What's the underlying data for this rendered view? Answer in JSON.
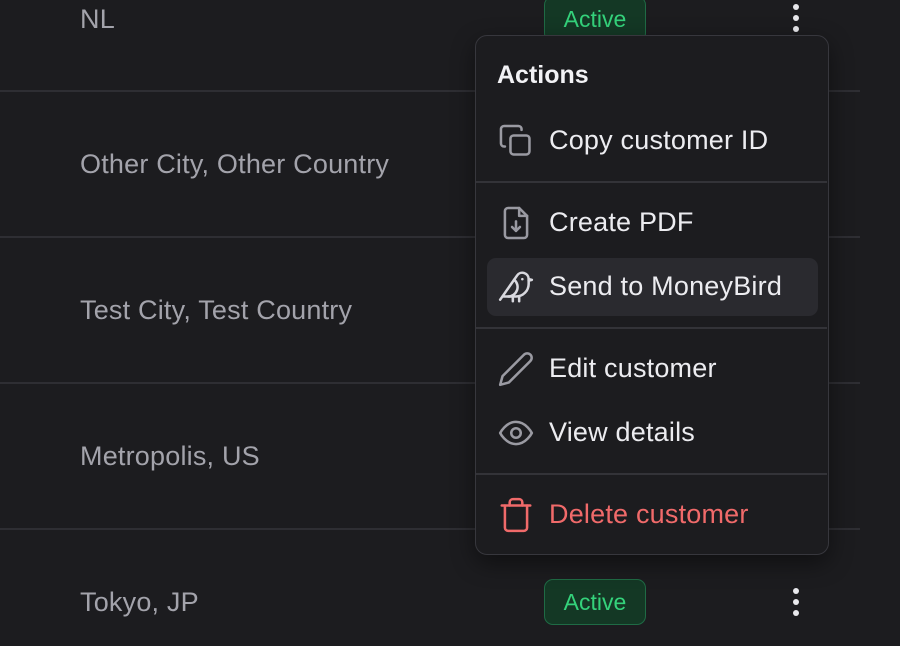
{
  "table": {
    "rows": [
      {
        "location": "NL",
        "status": "Active"
      },
      {
        "location": "Other City, Other Country",
        "status": ""
      },
      {
        "location": "Test City, Test Country",
        "status": ""
      },
      {
        "location": "Metropolis, US",
        "status": ""
      },
      {
        "location": "Tokyo, JP",
        "status": "Active"
      }
    ]
  },
  "menu": {
    "title": "Actions",
    "items": [
      {
        "label": "Copy customer ID",
        "icon": "copy-icon"
      },
      {
        "label": "Create PDF",
        "icon": "file-download-icon"
      },
      {
        "label": "Send to MoneyBird",
        "icon": "bird-icon"
      },
      {
        "label": "Edit customer",
        "icon": "pencil-icon"
      },
      {
        "label": "View details",
        "icon": "eye-icon"
      },
      {
        "label": "Delete customer",
        "icon": "trash-icon"
      }
    ]
  },
  "colors": {
    "background": "#1c1c1f",
    "active_badge_text": "#34d27b",
    "active_badge_bg": "#143825",
    "danger": "#f06a6a",
    "menu_highlight": "#2a2a2f"
  }
}
